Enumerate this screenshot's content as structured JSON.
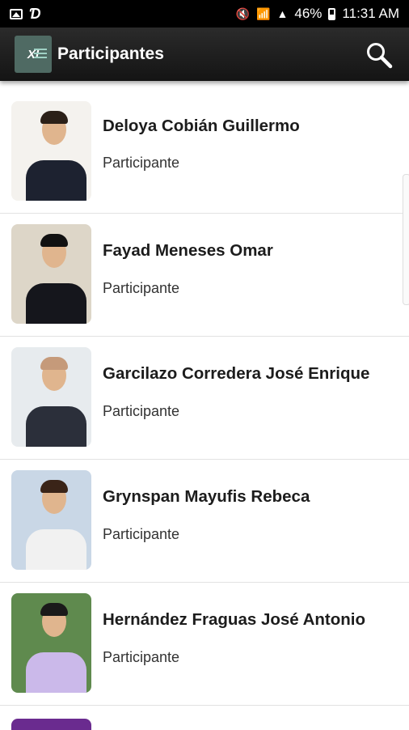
{
  "status_bar": {
    "battery": "46%",
    "time": "11:31 AM"
  },
  "app_bar": {
    "title": "Participantes",
    "logo_text": "XI",
    "search_icon": "search-icon"
  },
  "participants": [
    {
      "name": "Deloya Cobián Guillermo",
      "role": "Participante",
      "bg": "#f4f2ee",
      "suit": "#1d2230",
      "tie": "#5aa35a",
      "hair": "#2b2018"
    },
    {
      "name": "Fayad Meneses Omar",
      "role": "Participante",
      "bg": "#ddd6c8",
      "suit": "#15161c",
      "tie": "#8a1f24",
      "hair": "#111111"
    },
    {
      "name": "Garcilazo Corredera José Enrique",
      "role": "Participante",
      "bg": "#e7ebee",
      "suit": "#2b2f3a",
      "tie": "#3c3f4a",
      "hair": "#c59a7a"
    },
    {
      "name": "Grynspan Mayufis Rebeca",
      "role": "Participante",
      "bg": "#c9d7e6",
      "suit": "#f1f1f1",
      "tie": "#f1f1f1",
      "hair": "#3a2418"
    },
    {
      "name": "Hernández Fraguas José Antonio",
      "role": "Participante",
      "bg": "#5f8a4e",
      "suit": "#cbb9ea",
      "tie": "#cbb9ea",
      "hair": "#1a1a1a"
    }
  ]
}
